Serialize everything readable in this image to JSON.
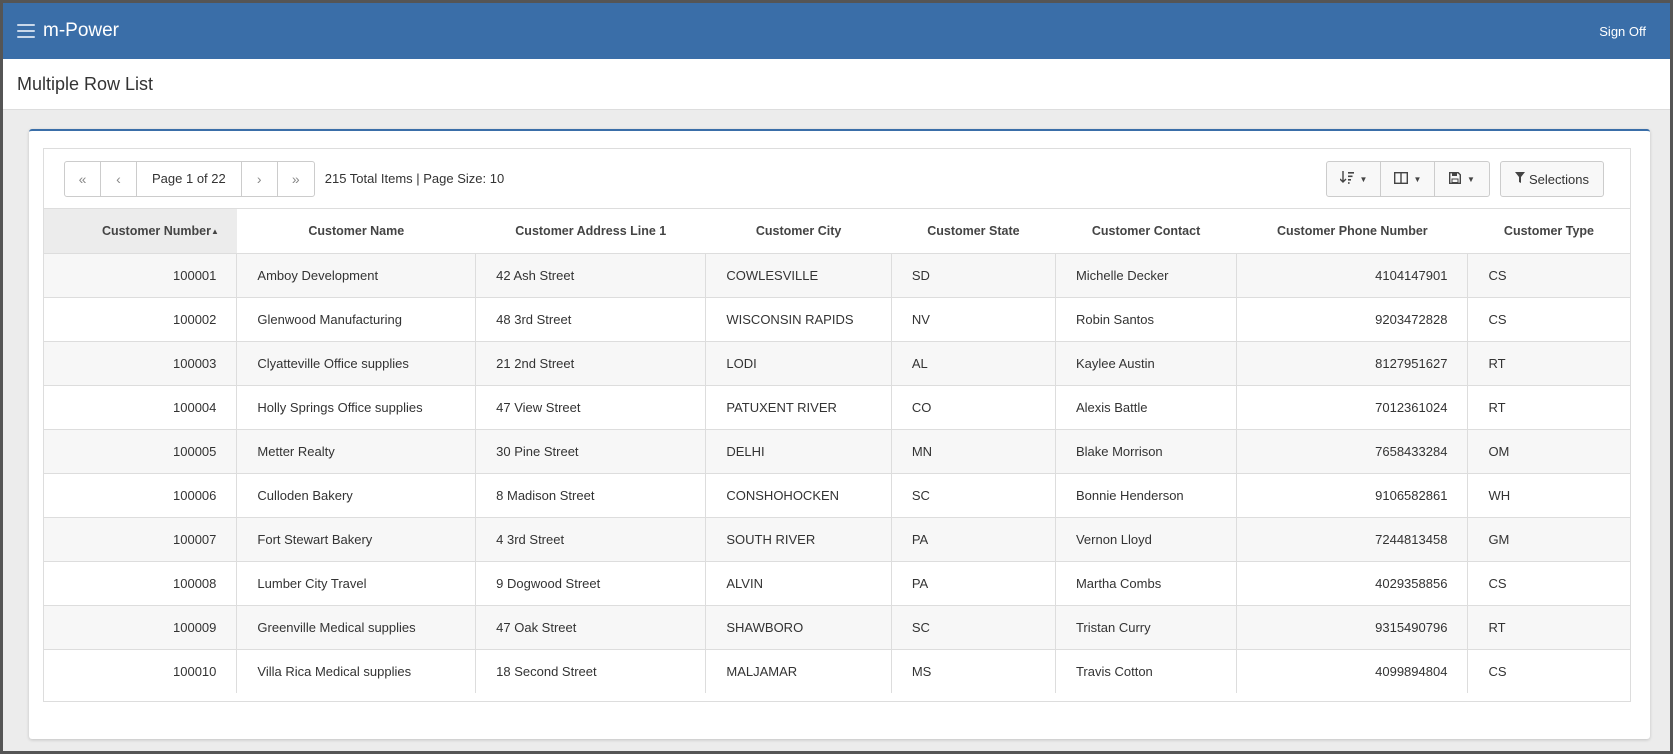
{
  "app": {
    "brand": "m-Power",
    "sign_off": "Sign Off"
  },
  "page": {
    "title": "Multiple Row List"
  },
  "pager": {
    "first": "«",
    "prev": "‹",
    "label": "Page 1 of 22",
    "next": "›",
    "last": "»",
    "summary": "215 Total Items | Page Size: 10"
  },
  "tools": {
    "sort_icon": "sort-icon",
    "columns_icon": "columns-icon",
    "save_icon": "save-icon",
    "selections": "Selections"
  },
  "table": {
    "sort_indicator": "▲",
    "columns": [
      "Customer Number",
      "Customer Name",
      "Customer Address Line 1",
      "Customer City",
      "Customer State",
      "Customer Contact",
      "Customer Phone Number",
      "Customer Type"
    ],
    "rows": [
      [
        "100001",
        "Amboy Development",
        "42 Ash Street",
        "COWLESVILLE",
        "SD",
        "Michelle Decker",
        "4104147901",
        "CS"
      ],
      [
        "100002",
        "Glenwood Manufacturing",
        "48 3rd Street",
        "WISCONSIN RAPIDS",
        "NV",
        "Robin Santos",
        "9203472828",
        "CS"
      ],
      [
        "100003",
        "Clyatteville Office supplies",
        "21 2nd Street",
        "LODI",
        "AL",
        "Kaylee Austin",
        "8127951627",
        "RT"
      ],
      [
        "100004",
        "Holly Springs Office supplies",
        "47 View Street",
        "PATUXENT RIVER",
        "CO",
        "Alexis Battle",
        "7012361024",
        "RT"
      ],
      [
        "100005",
        "Metter Realty",
        "30 Pine Street",
        "DELHI",
        "MN",
        "Blake Morrison",
        "7658433284",
        "OM"
      ],
      [
        "100006",
        "Culloden Bakery",
        "8 Madison Street",
        "CONSHOHOCKEN",
        "SC",
        "Bonnie Henderson",
        "9106582861",
        "WH"
      ],
      [
        "100007",
        "Fort Stewart Bakery",
        "4 3rd Street",
        "SOUTH RIVER",
        "PA",
        "Vernon Lloyd",
        "7244813458",
        "GM"
      ],
      [
        "100008",
        "Lumber City Travel",
        "9 Dogwood Street",
        "ALVIN",
        "PA",
        "Martha Combs",
        "4029358856",
        "CS"
      ],
      [
        "100009",
        "Greenville Medical supplies",
        "47 Oak Street",
        "SHAWBORO",
        "SC",
        "Tristan Curry",
        "9315490796",
        "RT"
      ],
      [
        "100010",
        "Villa Rica Medical supplies",
        "18 Second Street",
        "MALJAMAR",
        "MS",
        "Travis Cotton",
        "4099894804",
        "CS"
      ]
    ]
  }
}
